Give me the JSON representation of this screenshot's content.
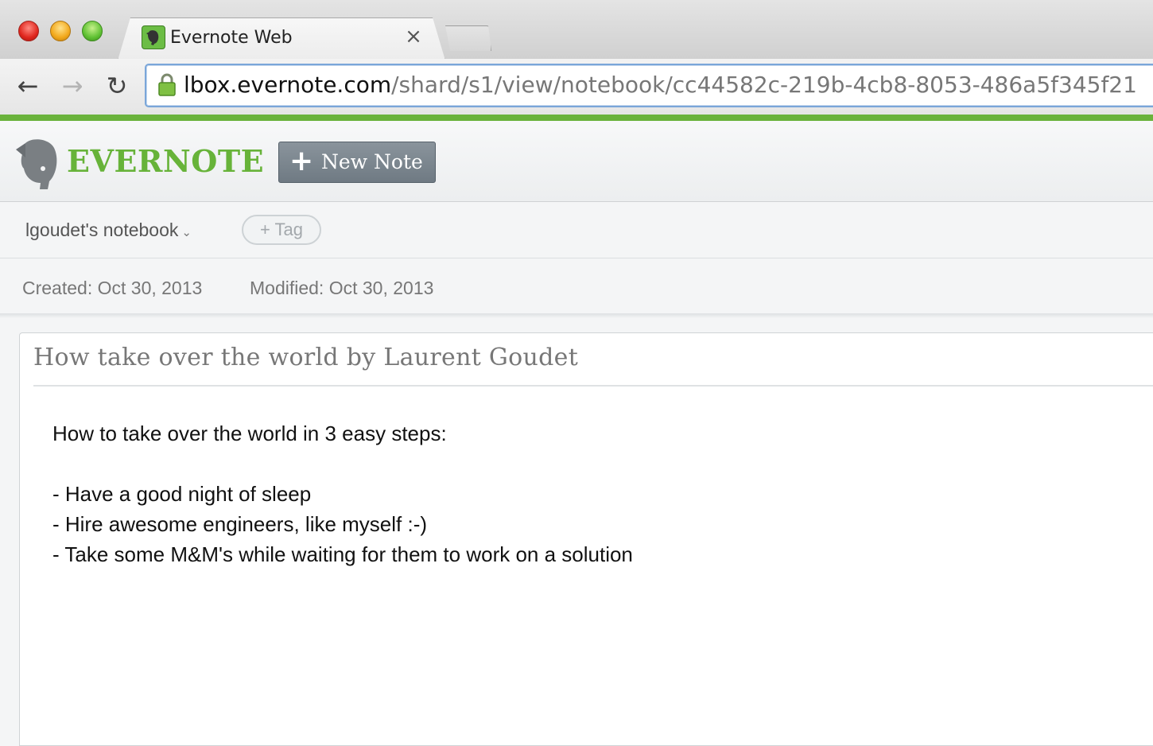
{
  "browser": {
    "tab_title": "Evernote Web",
    "tab_close": "×",
    "url_host": "lbox.evernote.com",
    "url_path": "/shard/s1/view/notebook/cc44582c-219b-4cb8-8053-486a5f345f21",
    "nav": {
      "back": "←",
      "forward": "→",
      "reload": "↻"
    }
  },
  "header": {
    "brand": "EVERNOTE",
    "new_note_plus": "+",
    "new_note_label": "New Note",
    "brand_color": "#67b339"
  },
  "notebook": {
    "name": "lgoudet's notebook",
    "chevron": "⌄",
    "tag_button": "+ Tag"
  },
  "dates": {
    "created": "Created: Oct 30, 2013",
    "modified": "Modified: Oct 30, 2013"
  },
  "note": {
    "title": "How take over the world by Laurent Goudet",
    "lines": [
      "How to take over the world in 3 easy steps:",
      "",
      "- Have a good night of sleep",
      "- Hire awesome engineers, like myself :-)",
      "- Take some M&M's while waiting for them to work on a solution"
    ]
  },
  "icons": {
    "close": "close-icon",
    "back": "back-arrow-icon",
    "forward": "forward-arrow-icon",
    "reload": "reload-icon",
    "lock": "lock-icon",
    "favicon": "evernote-favicon-icon",
    "logo": "evernote-elephant-icon",
    "plus": "plus-icon",
    "chevron": "chevron-down-icon"
  }
}
